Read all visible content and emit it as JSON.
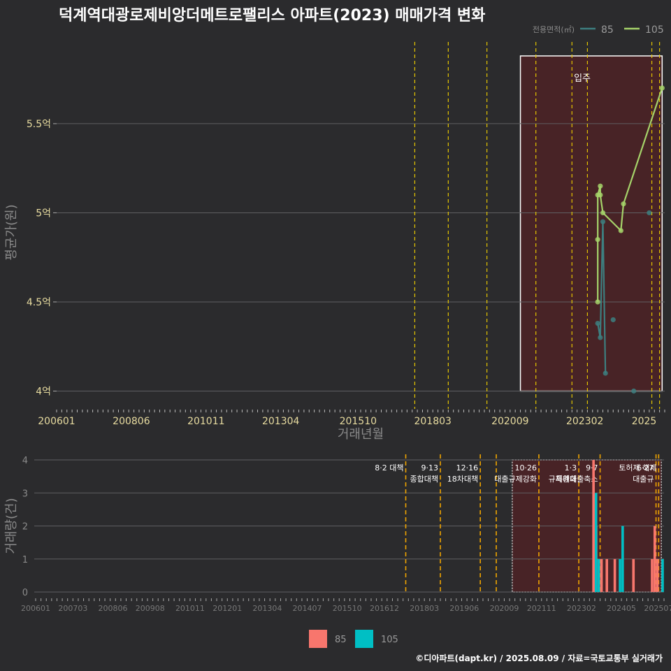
{
  "title": "덕계역대광로제비앙더메트로팰리스 아파트(2023) 매매가격 변화",
  "footer": "©디아파트(dapt.kr) / 2025.08.09 / 자료=국토교통부 실거래가",
  "colors": {
    "background": "#2b2b2d",
    "grid": "#5f5f62",
    "series_85_line": "#3d7f80",
    "series_105_line": "#a6d36a",
    "bar_85": "#f8766d",
    "bar_105": "#00bfc4",
    "policy_line": "#e5c600",
    "policy_line_bottom": "#f0a500",
    "highlight_fill": "#4a2326",
    "tick_text": "#e8dca0"
  },
  "chart_data": [
    {
      "type": "line",
      "legend_title": "전용면적(㎡)",
      "legend_position": "top-right",
      "xlabel": "거래년월",
      "ylabel": "평균가(원)",
      "x_ticks": [
        "200601",
        "200806",
        "201011",
        "201304",
        "201510",
        "201803",
        "202009",
        "202302",
        "2025"
      ],
      "y_ticks": [
        {
          "value": 4.0,
          "label": "4억"
        },
        {
          "value": 4.5,
          "label": "4.5억"
        },
        {
          "value": 5.0,
          "label": "5억"
        },
        {
          "value": 5.5,
          "label": "5.5억"
        }
      ],
      "ylim": [
        3.9,
        5.88
      ],
      "xlim": [
        "2006-01",
        "2025-09"
      ],
      "grid": true,
      "highlight": {
        "label": "입주",
        "from": "2021-01",
        "to": "2025-08"
      },
      "policy_dates": [
        "2017-08",
        "2018-09",
        "2019-12",
        "2021-07",
        "2022-09",
        "2023-03",
        "2025-04",
        "2025-07"
      ],
      "series": [
        {
          "name": "85",
          "points": [
            {
              "x": "2023-07",
              "y": 4.38
            },
            {
              "x": "2023-08",
              "y": 4.3
            },
            {
              "x": "2023-09",
              "y": 4.95
            },
            {
              "x": "2023-10",
              "y": 4.1
            },
            {
              "x": "2024-01",
              "y": 4.4
            },
            {
              "x": "2024-09",
              "y": 4.0
            },
            {
              "x": "2025-03",
              "y": 5.0
            }
          ],
          "line_to": "2023-10"
        },
        {
          "name": "105",
          "points": [
            {
              "x": "2023-07",
              "y": 4.5
            },
            {
              "x": "2023-07",
              "y": 4.85
            },
            {
              "x": "2023-07",
              "y": 5.1
            },
            {
              "x": "2023-08",
              "y": 5.15
            },
            {
              "x": "2023-08",
              "y": 5.1
            },
            {
              "x": "2023-09",
              "y": 5.0
            },
            {
              "x": "2024-04",
              "y": 4.9
            },
            {
              "x": "2024-05",
              "y": 5.05
            },
            {
              "x": "2025-08",
              "y": 5.7
            }
          ]
        }
      ]
    },
    {
      "type": "bar",
      "xlabel": "",
      "ylabel": "거래량(건)",
      "ylim": [
        0,
        4
      ],
      "y_ticks": [
        "0",
        "1",
        "2",
        "3",
        "4"
      ],
      "x_ticks": [
        "200601",
        "200703",
        "200806",
        "200908",
        "201011",
        "201201",
        "201304",
        "201407",
        "201510",
        "201612",
        "201803",
        "201906",
        "202009",
        "202111",
        "202302",
        "202405",
        "202507"
      ],
      "legend": [
        {
          "name": "85",
          "color": "#f8766d"
        },
        {
          "name": "105",
          "color": "#00bfc4"
        }
      ],
      "legend_position": "bottom",
      "highlight": {
        "from": "2020-12",
        "to": "2025-08"
      },
      "policies": [
        {
          "date": "2017-08",
          "labels": [
            "8·2 대책"
          ]
        },
        {
          "date": "2018-09",
          "labels": [
            "9·13",
            "종합대책"
          ]
        },
        {
          "date": "2019-12",
          "labels": [
            "12·16",
            "18차대책"
          ]
        },
        {
          "date": "2020-06",
          "labels": []
        },
        {
          "date": "2021-10",
          "labels": [
            "10·26",
            "대출규제강화"
          ]
        },
        {
          "date": "2023-01",
          "labels": [
            "1·3",
            "규제완화"
          ]
        },
        {
          "date": "2023-09",
          "labels": [
            "9·7",
            "특례대출축소"
          ]
        },
        {
          "date": "2025-06",
          "labels": [
            "6·27",
            "대출규"
          ]
        },
        {
          "date": "2025-07",
          "labels": [
            "토허제 해제"
          ]
        }
      ],
      "series": [
        {
          "name": "85",
          "points": [
            {
              "x": "2023-07",
              "y": 4
            },
            {
              "x": "2023-08",
              "y": 2
            },
            {
              "x": "2023-09",
              "y": 1
            },
            {
              "x": "2023-10",
              "y": 1
            },
            {
              "x": "2023-12",
              "y": 1
            },
            {
              "x": "2024-03",
              "y": 1
            },
            {
              "x": "2024-10",
              "y": 1
            },
            {
              "x": "2025-05",
              "y": 1
            },
            {
              "x": "2025-06",
              "y": 2
            },
            {
              "x": "2025-07",
              "y": 1
            }
          ]
        },
        {
          "name": "105",
          "points": [
            {
              "x": "2023-07",
              "y": 3
            },
            {
              "x": "2023-08",
              "y": 1
            },
            {
              "x": "2024-04",
              "y": 1
            },
            {
              "x": "2024-05",
              "y": 2
            },
            {
              "x": "2025-08",
              "y": 1
            }
          ]
        }
      ]
    }
  ]
}
